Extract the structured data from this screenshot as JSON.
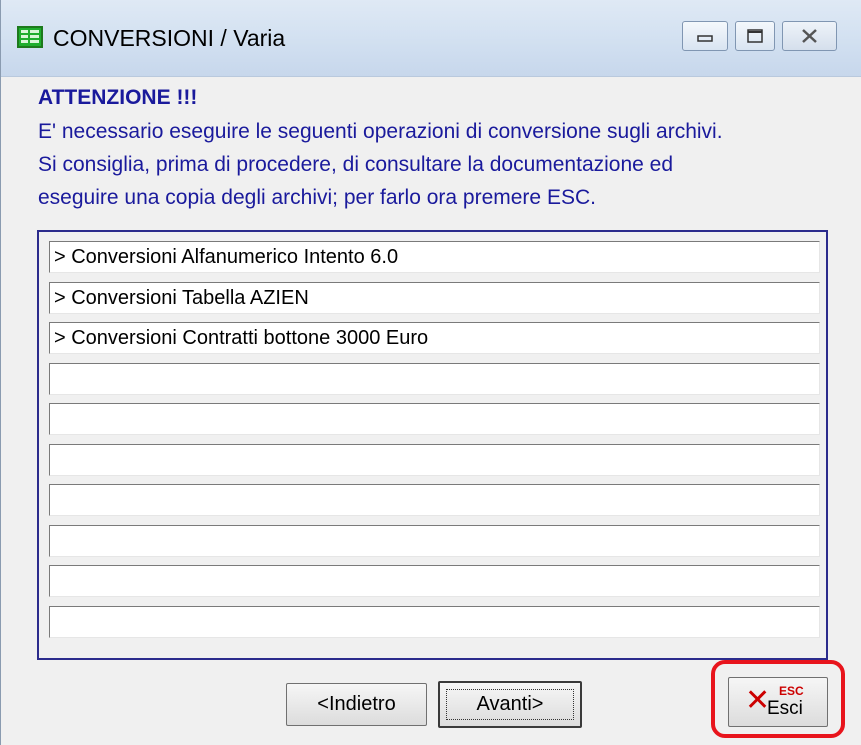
{
  "window": {
    "title": "CONVERSIONI / Varia"
  },
  "message": {
    "heading": "ATTENZIONE !!!",
    "line1": "E' necessario eseguire le seguenti operazioni di conversione sugli archivi.",
    "line2": "Si consiglia, prima di procedere, di  consultare la documentazione ed",
    "line3": "eseguire una copia degli archivi; per farlo ora premere ESC."
  },
  "conversions": [
    "> Conversioni Alfanumerico Intento 6.0",
    "> Conversioni Tabella AZIEN",
    "> Conversioni Contratti bottone 3000 Euro",
    "",
    "",
    "",
    "",
    "",
    "",
    ""
  ],
  "buttons": {
    "back": "<Indietro",
    "next": "Avanti>",
    "exit": "Esci",
    "exit_shortcut": "ESC"
  },
  "icons": {
    "app": "green-grid-icon",
    "exit": "red-x-icon"
  },
  "colors": {
    "text_accent": "#1a1a9c",
    "highlight": "#e8141c"
  }
}
